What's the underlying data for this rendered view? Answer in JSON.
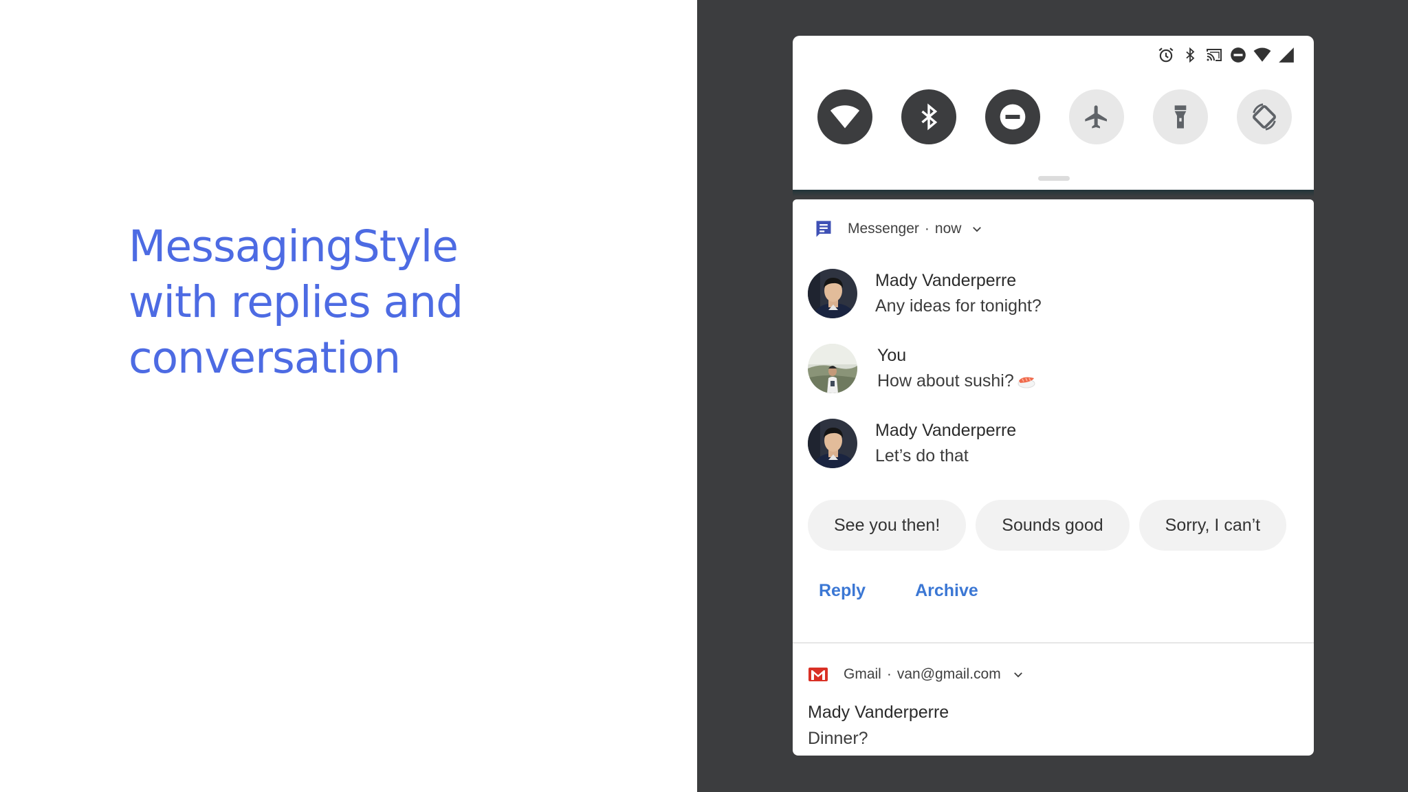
{
  "slide": {
    "title_lines": [
      "MessagingStyle",
      "with replies and",
      "conversation"
    ]
  },
  "status_bar": {
    "icons": [
      "alarm-icon",
      "bluetooth-icon",
      "cast-icon",
      "do-not-disturb-icon",
      "wifi-icon",
      "cell-signal-icon"
    ]
  },
  "quick_settings": {
    "tiles": [
      {
        "name": "wifi",
        "icon": "wifi-icon",
        "state": "on"
      },
      {
        "name": "bluetooth",
        "icon": "bluetooth-icon",
        "state": "on"
      },
      {
        "name": "do-not-disturb",
        "icon": "do-not-disturb-icon",
        "state": "on"
      },
      {
        "name": "airplane-mode",
        "icon": "airplane-icon",
        "state": "off"
      },
      {
        "name": "flashlight",
        "icon": "flashlight-icon",
        "state": "off"
      },
      {
        "name": "auto-rotate",
        "icon": "rotate-icon",
        "state": "off"
      }
    ]
  },
  "messenger": {
    "app_name": "Messenger",
    "separator": "·",
    "time": "now",
    "messages": [
      {
        "sender": "Mady Vanderperre",
        "text": "Any ideas for tonight?"
      },
      {
        "sender": "You",
        "text": "How about sushi?",
        "emoji": "sushi-emoji"
      },
      {
        "sender": "Mady Vanderperre",
        "text": "Let’s do that"
      }
    ],
    "smart_replies": [
      "See you then!",
      "Sounds good",
      "Sorry, I can’t"
    ],
    "actions": [
      "Reply",
      "Archive"
    ]
  },
  "gmail": {
    "app_name": "Gmail",
    "separator": "·",
    "account": "van@gmail.com",
    "sender": "Mady Vanderperre",
    "body": "Dinner?"
  },
  "colors": {
    "title_blue": "#4d6be3",
    "dark_bg": "#3c3d3f",
    "action_blue": "#3b77d4",
    "messenger_icon": "#3f51b5",
    "gmail_red": "#d93025"
  }
}
